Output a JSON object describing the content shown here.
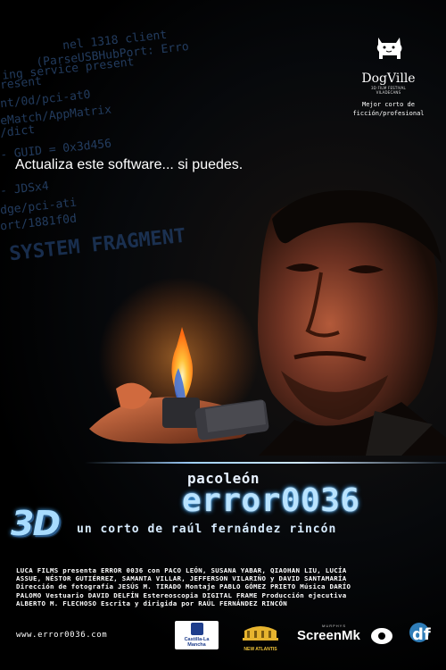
{
  "background_code": [
    "nel 1318 client",
    "(ParseUSBHubPort: Erro",
    "ing service present",
    "resent",
    "nt/0d/pci-at0",
    "eMatch/AppMatrix",
    "/dict",
    "- GUID = 0x3d456",
    "- JDSx4",
    "dge/pci-ati",
    "ort/1881f0d",
    "SYSTEM FRAGMENT"
  ],
  "festival": {
    "name": "DogVille",
    "small_line_1": "3D FILM FESTIVAL",
    "small_line_2": "VILADECANS",
    "award_line_1": "Mejor corto de",
    "award_line_2": "ficción/profesional"
  },
  "tagline": "Actualiza este software... si puedes.",
  "director_name": "pacoleón",
  "title": "error0036",
  "badge_3d": "3D",
  "subtitle": "un corto de raúl fernández rincón",
  "credits": [
    "LUCA FILMS presenta ERROR 0036 con PACO LEÓN, SUSANA YABAR, QIAOHAN LIU, LUCÍA",
    "ASSUE, NÉSTOR GUTIÉRREZ, SAMANTA VILLAR, JEFFERSON VILARIÑO y DAVID SANTAMARÍA",
    "Dirección de fotografía JESÚS M. TIRADO Montaje PABLO GÓMEZ PRIETO Música DARÍO",
    "PALOMO Vestuario DAVID DELFÍN Estereoscopia DIGITAL FRAME Producción ejecutiva",
    "ALBERTO M. FLECHOSO Escrita y dirigida por RAÚL FERNÁNDEZ RINCÓN"
  ],
  "website": "www.error0036.com",
  "sponsors": {
    "castilla": "Castilla-La Mancha",
    "new_atlantis": "NEW ATLANTIS",
    "screenmk_top": "MURPHYS",
    "screenmk": "ScreenMk",
    "df": "df"
  },
  "colors": {
    "title_glow": "#3aa8ff",
    "flame": "#ffb020",
    "background": "#000000"
  }
}
